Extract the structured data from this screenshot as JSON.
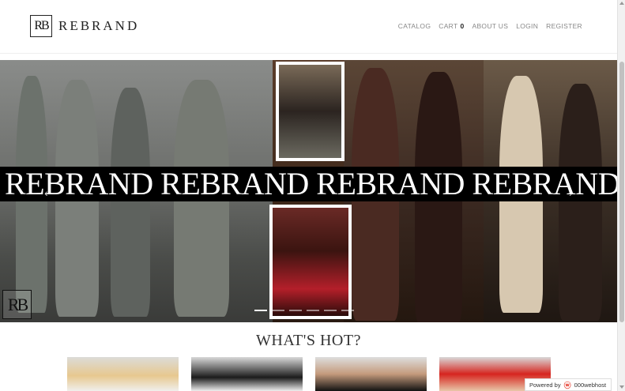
{
  "header": {
    "logo_mark": "RB",
    "logo_text": "REBRAND",
    "nav": {
      "catalog": "CATALOG",
      "cart": "CART",
      "cart_count": "0",
      "about": "ABOUT US",
      "login": "LOGIN",
      "register": "REGISTER"
    }
  },
  "hero": {
    "banner_text": "REBRAND REBRAND REBRAND REBRAND",
    "logo_mark": "RB",
    "prev_icon": "chevron-left-icon",
    "next_icon": "chevron-right-icon",
    "slides_count": 6,
    "active_slide": 1
  },
  "section": {
    "title": "WHAT'S HOT?"
  },
  "footer_badge": {
    "powered_by": "Powered by",
    "host": "000webhost"
  },
  "colors": {
    "banner_bg": "#000000",
    "banner_text": "#ffffff",
    "nav_text": "#888888",
    "host_accent": "#e63a2c"
  }
}
